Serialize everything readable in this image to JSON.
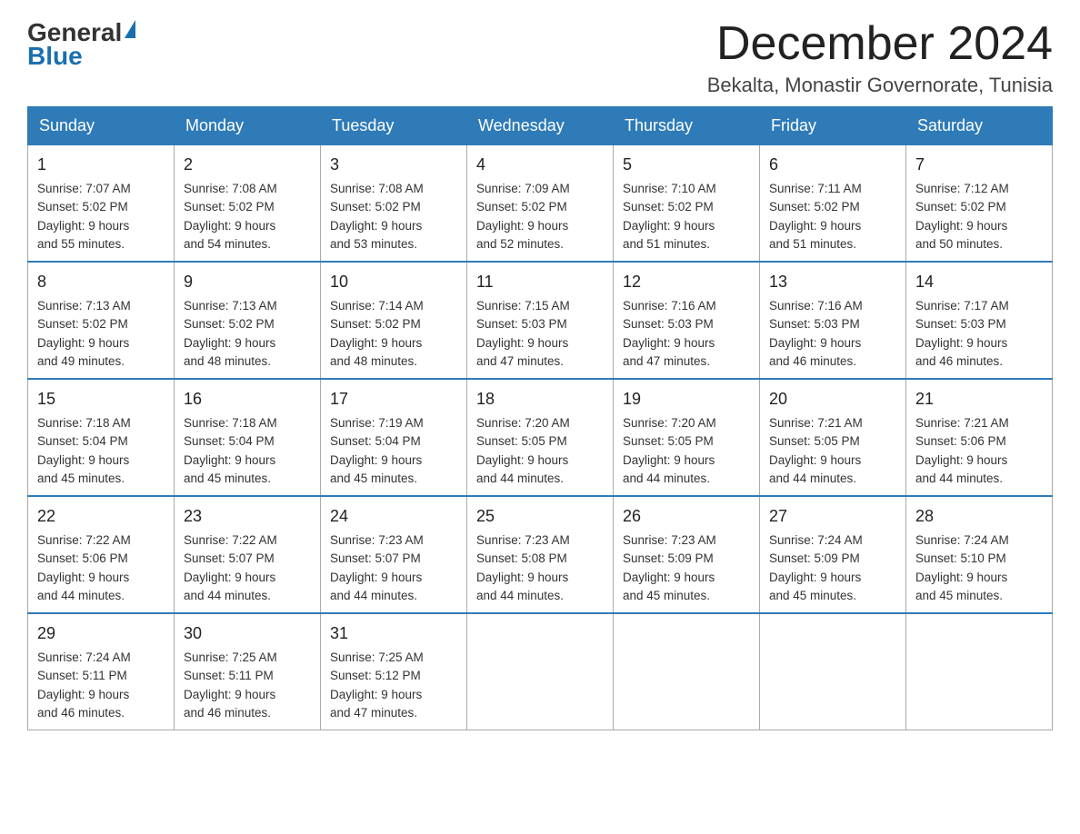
{
  "header": {
    "logo_general": "General",
    "logo_blue": "Blue",
    "month_title": "December 2024",
    "location": "Bekalta, Monastir Governorate, Tunisia"
  },
  "days_of_week": [
    "Sunday",
    "Monday",
    "Tuesday",
    "Wednesday",
    "Thursday",
    "Friday",
    "Saturday"
  ],
  "weeks": [
    [
      {
        "day": 1,
        "sunrise": "7:07 AM",
        "sunset": "5:02 PM",
        "daylight": "9 hours and 55 minutes."
      },
      {
        "day": 2,
        "sunrise": "7:08 AM",
        "sunset": "5:02 PM",
        "daylight": "9 hours and 54 minutes."
      },
      {
        "day": 3,
        "sunrise": "7:08 AM",
        "sunset": "5:02 PM",
        "daylight": "9 hours and 53 minutes."
      },
      {
        "day": 4,
        "sunrise": "7:09 AM",
        "sunset": "5:02 PM",
        "daylight": "9 hours and 52 minutes."
      },
      {
        "day": 5,
        "sunrise": "7:10 AM",
        "sunset": "5:02 PM",
        "daylight": "9 hours and 51 minutes."
      },
      {
        "day": 6,
        "sunrise": "7:11 AM",
        "sunset": "5:02 PM",
        "daylight": "9 hours and 51 minutes."
      },
      {
        "day": 7,
        "sunrise": "7:12 AM",
        "sunset": "5:02 PM",
        "daylight": "9 hours and 50 minutes."
      }
    ],
    [
      {
        "day": 8,
        "sunrise": "7:13 AM",
        "sunset": "5:02 PM",
        "daylight": "9 hours and 49 minutes."
      },
      {
        "day": 9,
        "sunrise": "7:13 AM",
        "sunset": "5:02 PM",
        "daylight": "9 hours and 48 minutes."
      },
      {
        "day": 10,
        "sunrise": "7:14 AM",
        "sunset": "5:02 PM",
        "daylight": "9 hours and 48 minutes."
      },
      {
        "day": 11,
        "sunrise": "7:15 AM",
        "sunset": "5:03 PM",
        "daylight": "9 hours and 47 minutes."
      },
      {
        "day": 12,
        "sunrise": "7:16 AM",
        "sunset": "5:03 PM",
        "daylight": "9 hours and 47 minutes."
      },
      {
        "day": 13,
        "sunrise": "7:16 AM",
        "sunset": "5:03 PM",
        "daylight": "9 hours and 46 minutes."
      },
      {
        "day": 14,
        "sunrise": "7:17 AM",
        "sunset": "5:03 PM",
        "daylight": "9 hours and 46 minutes."
      }
    ],
    [
      {
        "day": 15,
        "sunrise": "7:18 AM",
        "sunset": "5:04 PM",
        "daylight": "9 hours and 45 minutes."
      },
      {
        "day": 16,
        "sunrise": "7:18 AM",
        "sunset": "5:04 PM",
        "daylight": "9 hours and 45 minutes."
      },
      {
        "day": 17,
        "sunrise": "7:19 AM",
        "sunset": "5:04 PM",
        "daylight": "9 hours and 45 minutes."
      },
      {
        "day": 18,
        "sunrise": "7:20 AM",
        "sunset": "5:05 PM",
        "daylight": "9 hours and 44 minutes."
      },
      {
        "day": 19,
        "sunrise": "7:20 AM",
        "sunset": "5:05 PM",
        "daylight": "9 hours and 44 minutes."
      },
      {
        "day": 20,
        "sunrise": "7:21 AM",
        "sunset": "5:05 PM",
        "daylight": "9 hours and 44 minutes."
      },
      {
        "day": 21,
        "sunrise": "7:21 AM",
        "sunset": "5:06 PM",
        "daylight": "9 hours and 44 minutes."
      }
    ],
    [
      {
        "day": 22,
        "sunrise": "7:22 AM",
        "sunset": "5:06 PM",
        "daylight": "9 hours and 44 minutes."
      },
      {
        "day": 23,
        "sunrise": "7:22 AM",
        "sunset": "5:07 PM",
        "daylight": "9 hours and 44 minutes."
      },
      {
        "day": 24,
        "sunrise": "7:23 AM",
        "sunset": "5:07 PM",
        "daylight": "9 hours and 44 minutes."
      },
      {
        "day": 25,
        "sunrise": "7:23 AM",
        "sunset": "5:08 PM",
        "daylight": "9 hours and 44 minutes."
      },
      {
        "day": 26,
        "sunrise": "7:23 AM",
        "sunset": "5:09 PM",
        "daylight": "9 hours and 45 minutes."
      },
      {
        "day": 27,
        "sunrise": "7:24 AM",
        "sunset": "5:09 PM",
        "daylight": "9 hours and 45 minutes."
      },
      {
        "day": 28,
        "sunrise": "7:24 AM",
        "sunset": "5:10 PM",
        "daylight": "9 hours and 45 minutes."
      }
    ],
    [
      {
        "day": 29,
        "sunrise": "7:24 AM",
        "sunset": "5:11 PM",
        "daylight": "9 hours and 46 minutes."
      },
      {
        "day": 30,
        "sunrise": "7:25 AM",
        "sunset": "5:11 PM",
        "daylight": "9 hours and 46 minutes."
      },
      {
        "day": 31,
        "sunrise": "7:25 AM",
        "sunset": "5:12 PM",
        "daylight": "9 hours and 47 minutes."
      },
      null,
      null,
      null,
      null
    ]
  ],
  "cell_labels": {
    "sunrise": "Sunrise:",
    "sunset": "Sunset:",
    "daylight": "Daylight:"
  }
}
